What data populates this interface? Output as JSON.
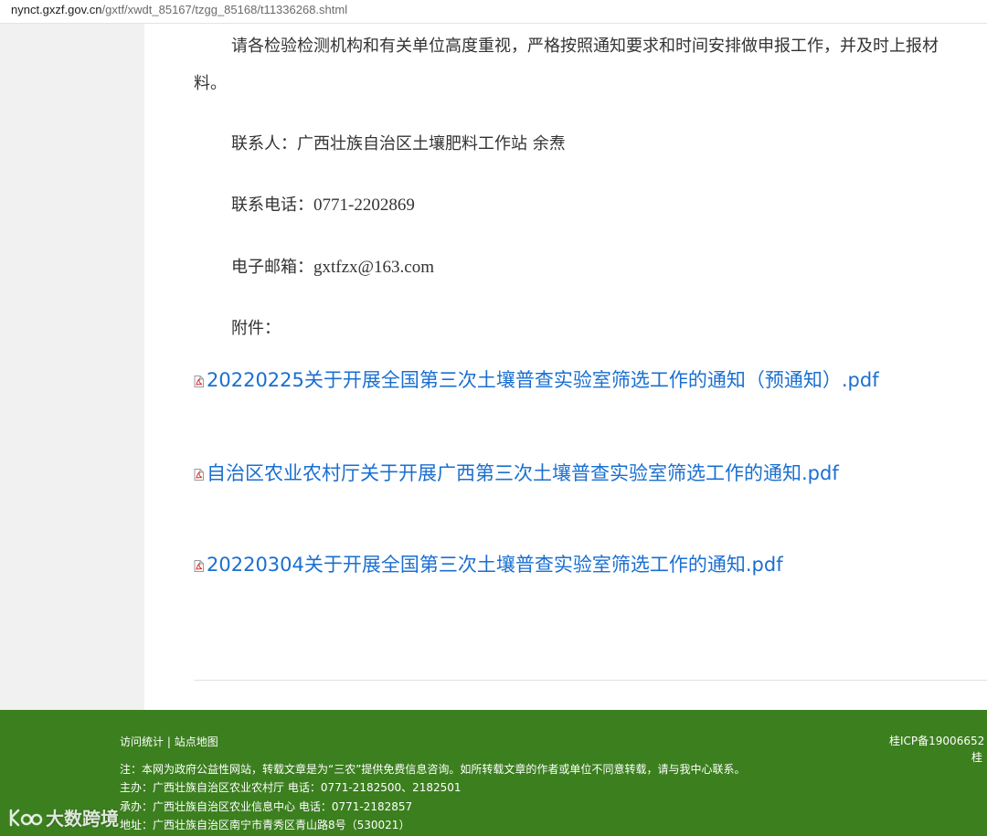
{
  "browser": {
    "url_host": "nynct.gxzf.gov.cn",
    "url_path": "/gxtf/xwdt_85167/tzgg_85168/t11336268.shtml"
  },
  "article": {
    "notice_line1": "请各检验检测机构和有关单位高度重视，严格按照通知要求和时间安排做申报工作，并及时上报材",
    "notice_line2": "料。",
    "contact_label": "联系人：",
    "contact_value": "广西壮族自治区土壤肥料工作站   余焘",
    "phone_label": "联系电话：",
    "phone_value": "0771-2202869",
    "email_label": "电子邮箱：",
    "email_value": "gxtfzx@163.com",
    "attachments_label": "附件："
  },
  "attachments": [
    {
      "label": "20220225关于开展全国第三次土壤普查实验室筛选工作的通知（预通知）.pdf",
      "icon": "pdf-icon"
    },
    {
      "label": "自治区农业农村厅关于开展广西第三次土壤普查实验室筛选工作的通知.pdf",
      "icon": "pdf-icon"
    },
    {
      "label": "20220304关于开展全国第三次土壤普查实验室筛选工作的通知.pdf",
      "icon": "pdf-icon"
    }
  ],
  "footer": {
    "visit_stats": "访问统计",
    "separator": "|",
    "site_map": "站点地图",
    "icp": "桂ICP备19006652",
    "icp_line2": "桂",
    "note": "注：本网为政府公益性网站，转载文章是为“三农”提供免费信息咨询。如所转载文章的作者或单位不同意转载，请与我中心联系。",
    "sponsor": "主办：广西壮族自治区农业农村厅 电话：0771-2182500、2182501",
    "organizer": "承办：广西壮族自治区农业信息中心 电话：0771-2182857",
    "address": "地址：广西壮族自治区南宁市青秀区青山路8号（530021）",
    "bg_color": "#3c7f1f"
  },
  "watermark": {
    "text": "大数跨境"
  },
  "colors": {
    "link": "#1a6fd1",
    "body_text": "#333333",
    "gutter": "#f1f1f1"
  }
}
